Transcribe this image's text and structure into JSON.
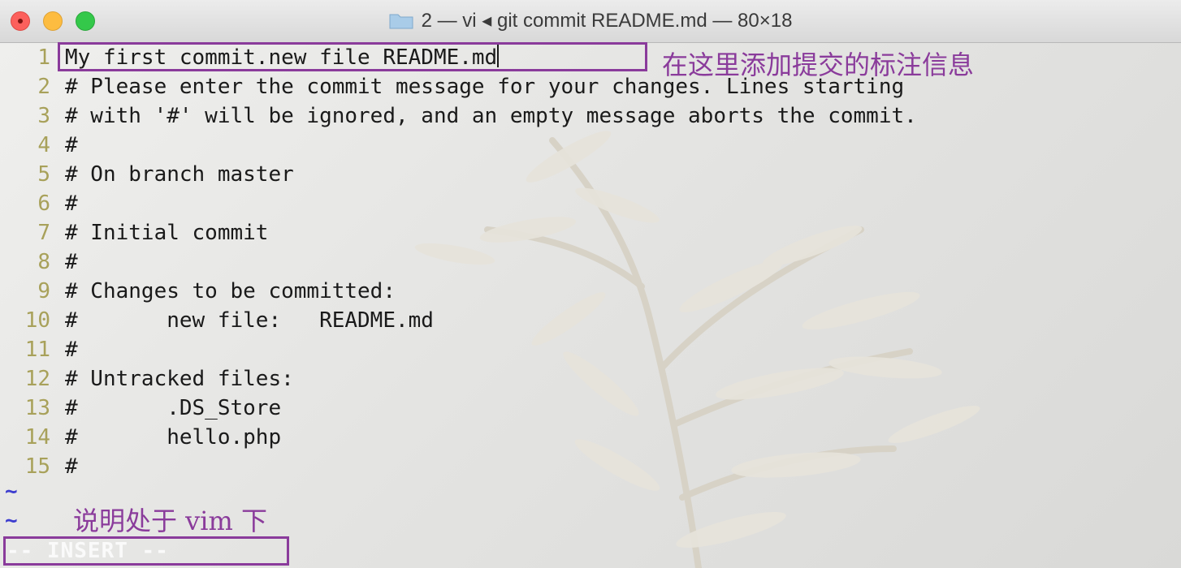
{
  "window": {
    "title": "2 — vi ◂ git commit README.md — 80×18"
  },
  "editor": {
    "lines": [
      {
        "num": "1",
        "text": "My first commit.new file README.md"
      },
      {
        "num": "2",
        "text": "# Please enter the commit message for your changes. Lines starting"
      },
      {
        "num": "3",
        "text": "# with '#' will be ignored, and an empty message aborts the commit."
      },
      {
        "num": "4",
        "text": "#"
      },
      {
        "num": "5",
        "text": "# On branch master"
      },
      {
        "num": "6",
        "text": "#"
      },
      {
        "num": "7",
        "text": "# Initial commit"
      },
      {
        "num": "8",
        "text": "#"
      },
      {
        "num": "9",
        "text": "# Changes to be committed:"
      },
      {
        "num": "10",
        "text": "#       new file:   README.md"
      },
      {
        "num": "11",
        "text": "#"
      },
      {
        "num": "12",
        "text": "# Untracked files:"
      },
      {
        "num": "13",
        "text": "#       .DS_Store"
      },
      {
        "num": "14",
        "text": "#       hello.php"
      },
      {
        "num": "15",
        "text": "#"
      }
    ],
    "tildes": [
      "~",
      "~"
    ],
    "mode": "-- INSERT --"
  },
  "annotations": {
    "commit_note": "在这里添加提交的标注信息",
    "vim_note": "说明处于 vim 下"
  },
  "colors": {
    "line_number": "#a8a15a",
    "annotation": "#8a3b9b",
    "tilde": "#3d3dcf"
  }
}
